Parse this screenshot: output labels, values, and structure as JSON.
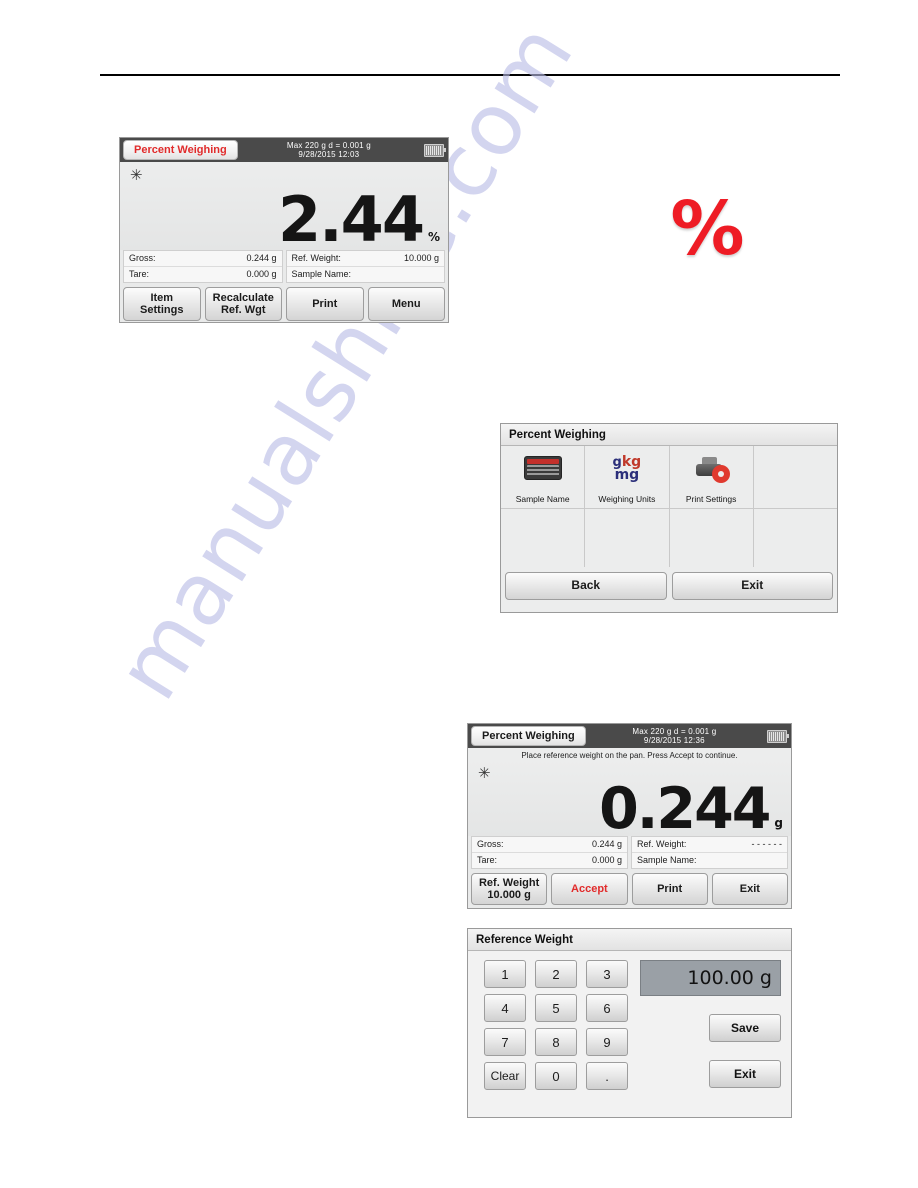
{
  "page": {
    "watermark": "manualshive.com"
  },
  "illustration": {
    "percent_glyph": "%"
  },
  "screen_percent_result": {
    "title": "Percent Weighing",
    "capacity": "Max 220 g   d = 0.001 g",
    "datetime": "9/28/2015  12:03",
    "battery_icon": "battery-icon",
    "stability_marker": "✳",
    "value": "2.44",
    "unit": "%",
    "info": {
      "gross_label": "Gross:",
      "gross_value": "0.244 g",
      "tare_label": "Tare:",
      "tare_value": "0.000 g",
      "ref_weight_label": "Ref. Weight:",
      "ref_weight_value": "10.000 g",
      "sample_name_label": "Sample Name:",
      "sample_name_value": ""
    },
    "keys": [
      {
        "line1": "Item",
        "line2": "Settings"
      },
      {
        "line1": "Recalculate",
        "line2": "Ref. Wgt"
      },
      {
        "line1": "Print",
        "line2": ""
      },
      {
        "line1": "Menu",
        "line2": ""
      }
    ]
  },
  "screen_percent_menu": {
    "title": "Percent Weighing",
    "items": [
      {
        "label": "Sample Name",
        "icon": "keyboard-icon"
      },
      {
        "label": "Weighing Units",
        "icon": "weighing-units-icon"
      },
      {
        "label": "Print Settings",
        "icon": "printer-gear-icon"
      }
    ],
    "units_icon": {
      "g": "g",
      "kg": "kg",
      "mg": "mg"
    },
    "footer": {
      "back_label": "Back",
      "exit_label": "Exit"
    }
  },
  "screen_percent_ref": {
    "title": "Percent Weighing",
    "capacity": "Max 220 g   d = 0.001 g",
    "datetime": "9/28/2015  12:36",
    "battery_icon": "battery-icon",
    "instruction": "Place reference weight on the pan.  Press Accept to continue.",
    "stability_marker": "✳",
    "value": "0.244",
    "unit": "g",
    "info": {
      "gross_label": "Gross:",
      "gross_value": "0.244 g",
      "tare_label": "Tare:",
      "tare_value": "0.000 g",
      "ref_weight_label": "Ref. Weight:",
      "ref_weight_value": "- - - - - -",
      "sample_name_label": "Sample Name:",
      "sample_name_value": ""
    },
    "keys": [
      {
        "line1": "Ref. Weight",
        "line2": "10.000 g"
      },
      {
        "line1": "Accept",
        "line2": ""
      },
      {
        "line1": "Print",
        "line2": ""
      },
      {
        "line1": "Exit",
        "line2": ""
      }
    ]
  },
  "screen_reference_weight": {
    "title": "Reference Weight",
    "display_value": "100.00 g",
    "keypad": [
      "1",
      "2",
      "3",
      "4",
      "5",
      "6",
      "7",
      "8",
      "9",
      "Clear",
      "0",
      "."
    ],
    "save_label": "Save",
    "exit_label": "Exit"
  },
  "colors": {
    "title_red": "#e12b2b",
    "accept_red": "#e12b2b",
    "glyph_red": "#ee1c25",
    "topbar_dark": "#4a4a4a",
    "screen_bg": "#e9eaea",
    "value_field_gray": "#9aa0a6",
    "watermark": "#b9bce6"
  }
}
